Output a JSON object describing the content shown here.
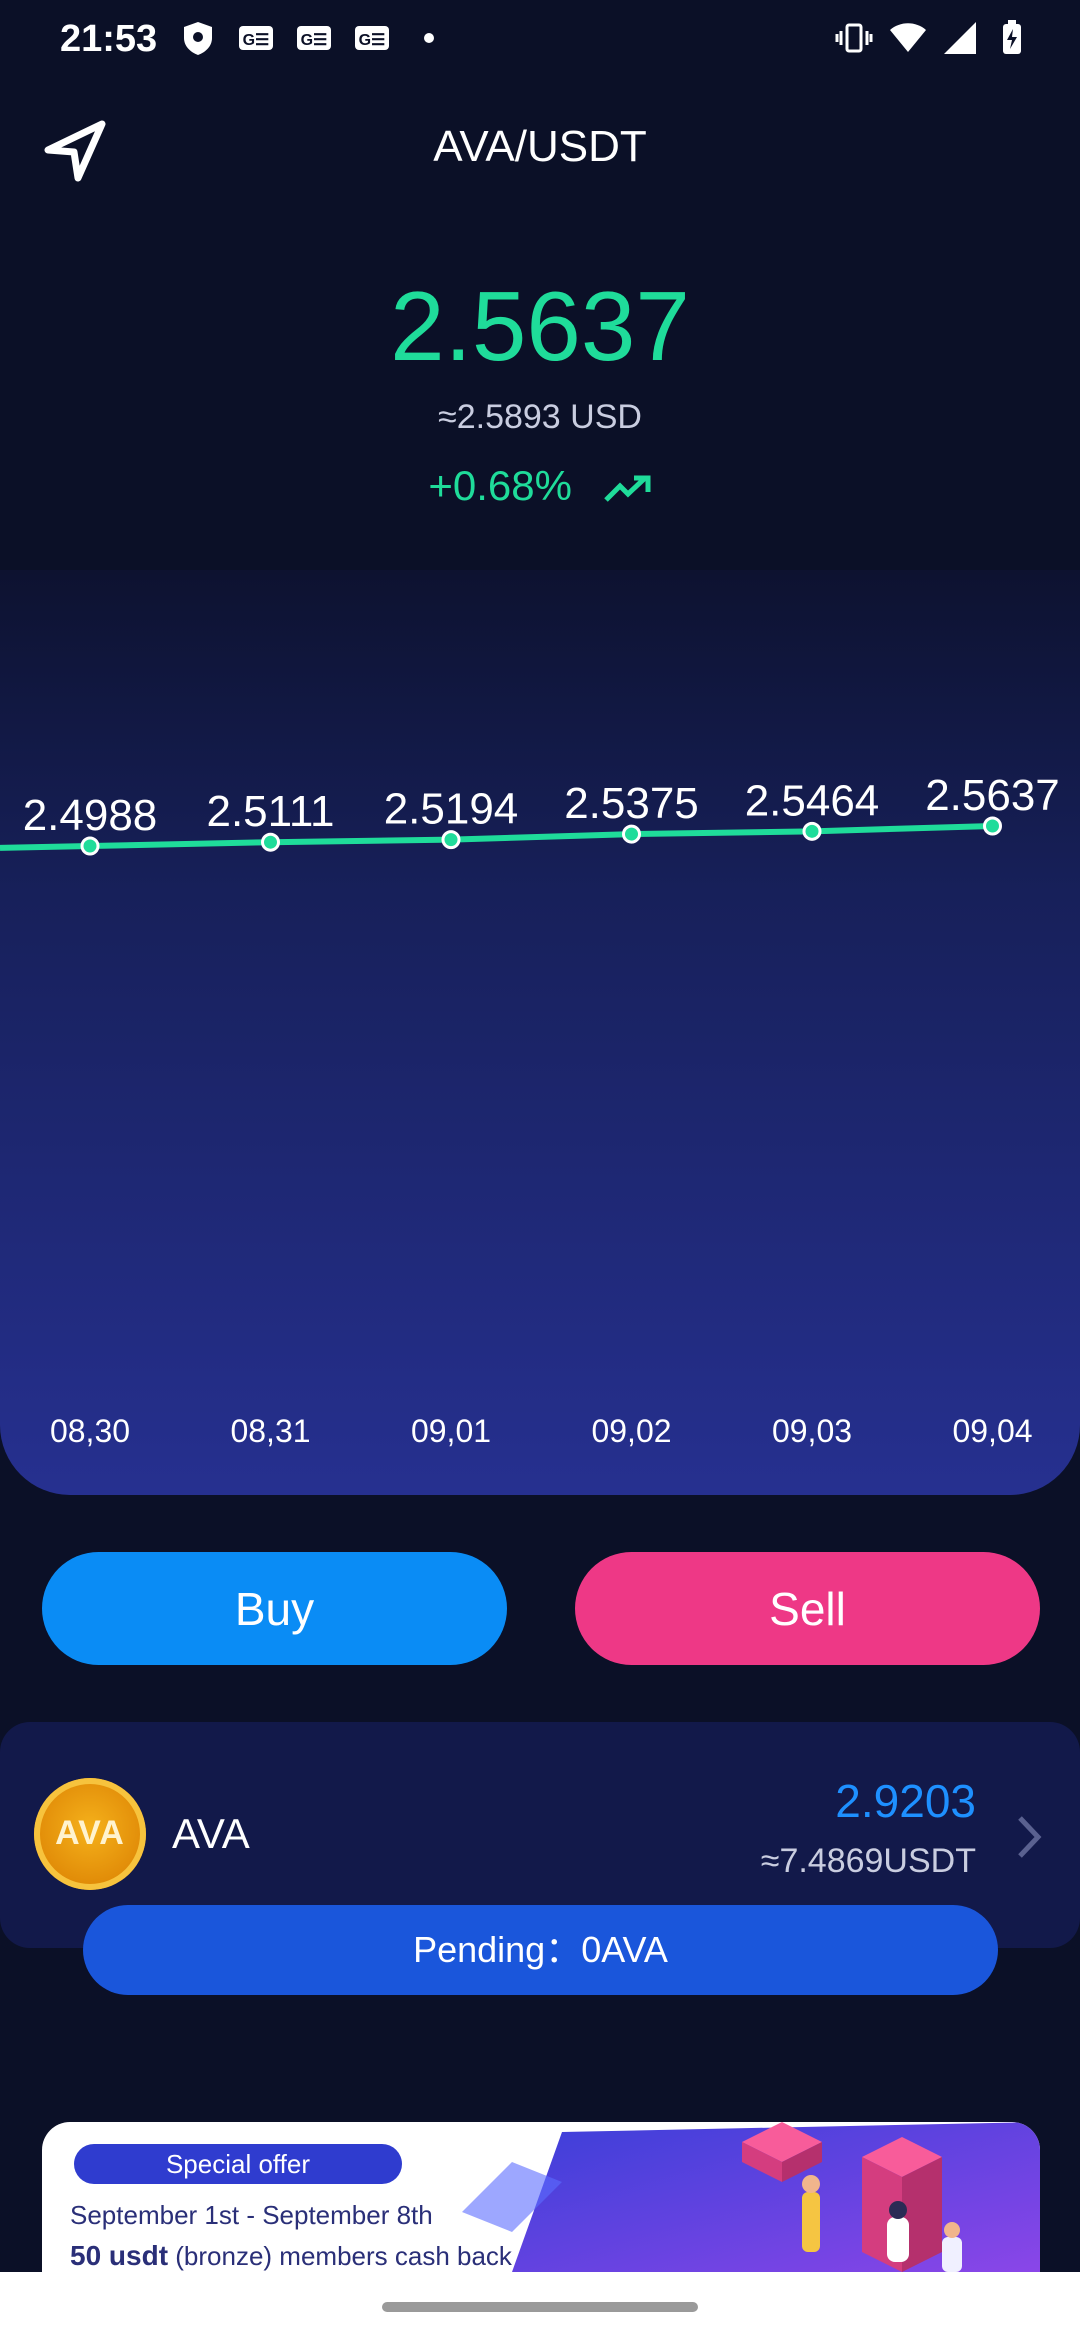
{
  "status_bar": {
    "time": "21:53",
    "icons": [
      "shield-icon",
      "ge-icon",
      "ge-icon",
      "ge-icon",
      "dot-icon",
      "vibrate-icon",
      "wifi-icon",
      "signal-icon",
      "battery-charging-icon"
    ]
  },
  "header": {
    "title": "AVA/USDT",
    "back_icon": "send-arrow-back-icon"
  },
  "ticker": {
    "price": "2.5637",
    "usd_value": "≈2.5893 USD",
    "change": "+0.68%",
    "trend_icon": "trending-up-icon"
  },
  "chart_data": {
    "type": "line",
    "x": [
      "08,30",
      "08,31",
      "09,01",
      "09,02",
      "09,03",
      "09,04"
    ],
    "series": [
      {
        "values": [
          2.4988,
          2.5111,
          2.5194,
          2.5375,
          2.5464,
          2.5637
        ]
      }
    ],
    "data_labels": [
      "2.4988",
      "2.5111",
      "2.5194",
      "2.5375",
      "2.5464",
      "2.5637"
    ],
    "title": "",
    "xlabel": "",
    "ylabel": "",
    "grid": false,
    "legend": "none",
    "colors": {
      "line": "#1fdc9a"
    }
  },
  "actions": {
    "buy_label": "Buy",
    "sell_label": "Sell"
  },
  "asset": {
    "logo_text": "AVA",
    "name": "AVA",
    "balance": "2.9203",
    "approx": "≈7.4869USDT",
    "pending": "Pending：0AVA"
  },
  "banner": {
    "pill": "Special offer",
    "dates": "September 1st - September 8th",
    "amount": "50 usdt",
    "rest": " (bronze) members cash back"
  },
  "colors": {
    "accent_green": "#1fdc9a",
    "buy": "#0a8cf5",
    "sell": "#ee3886",
    "balance_blue": "#1e90ff",
    "pending_bg": "#1a56db"
  }
}
